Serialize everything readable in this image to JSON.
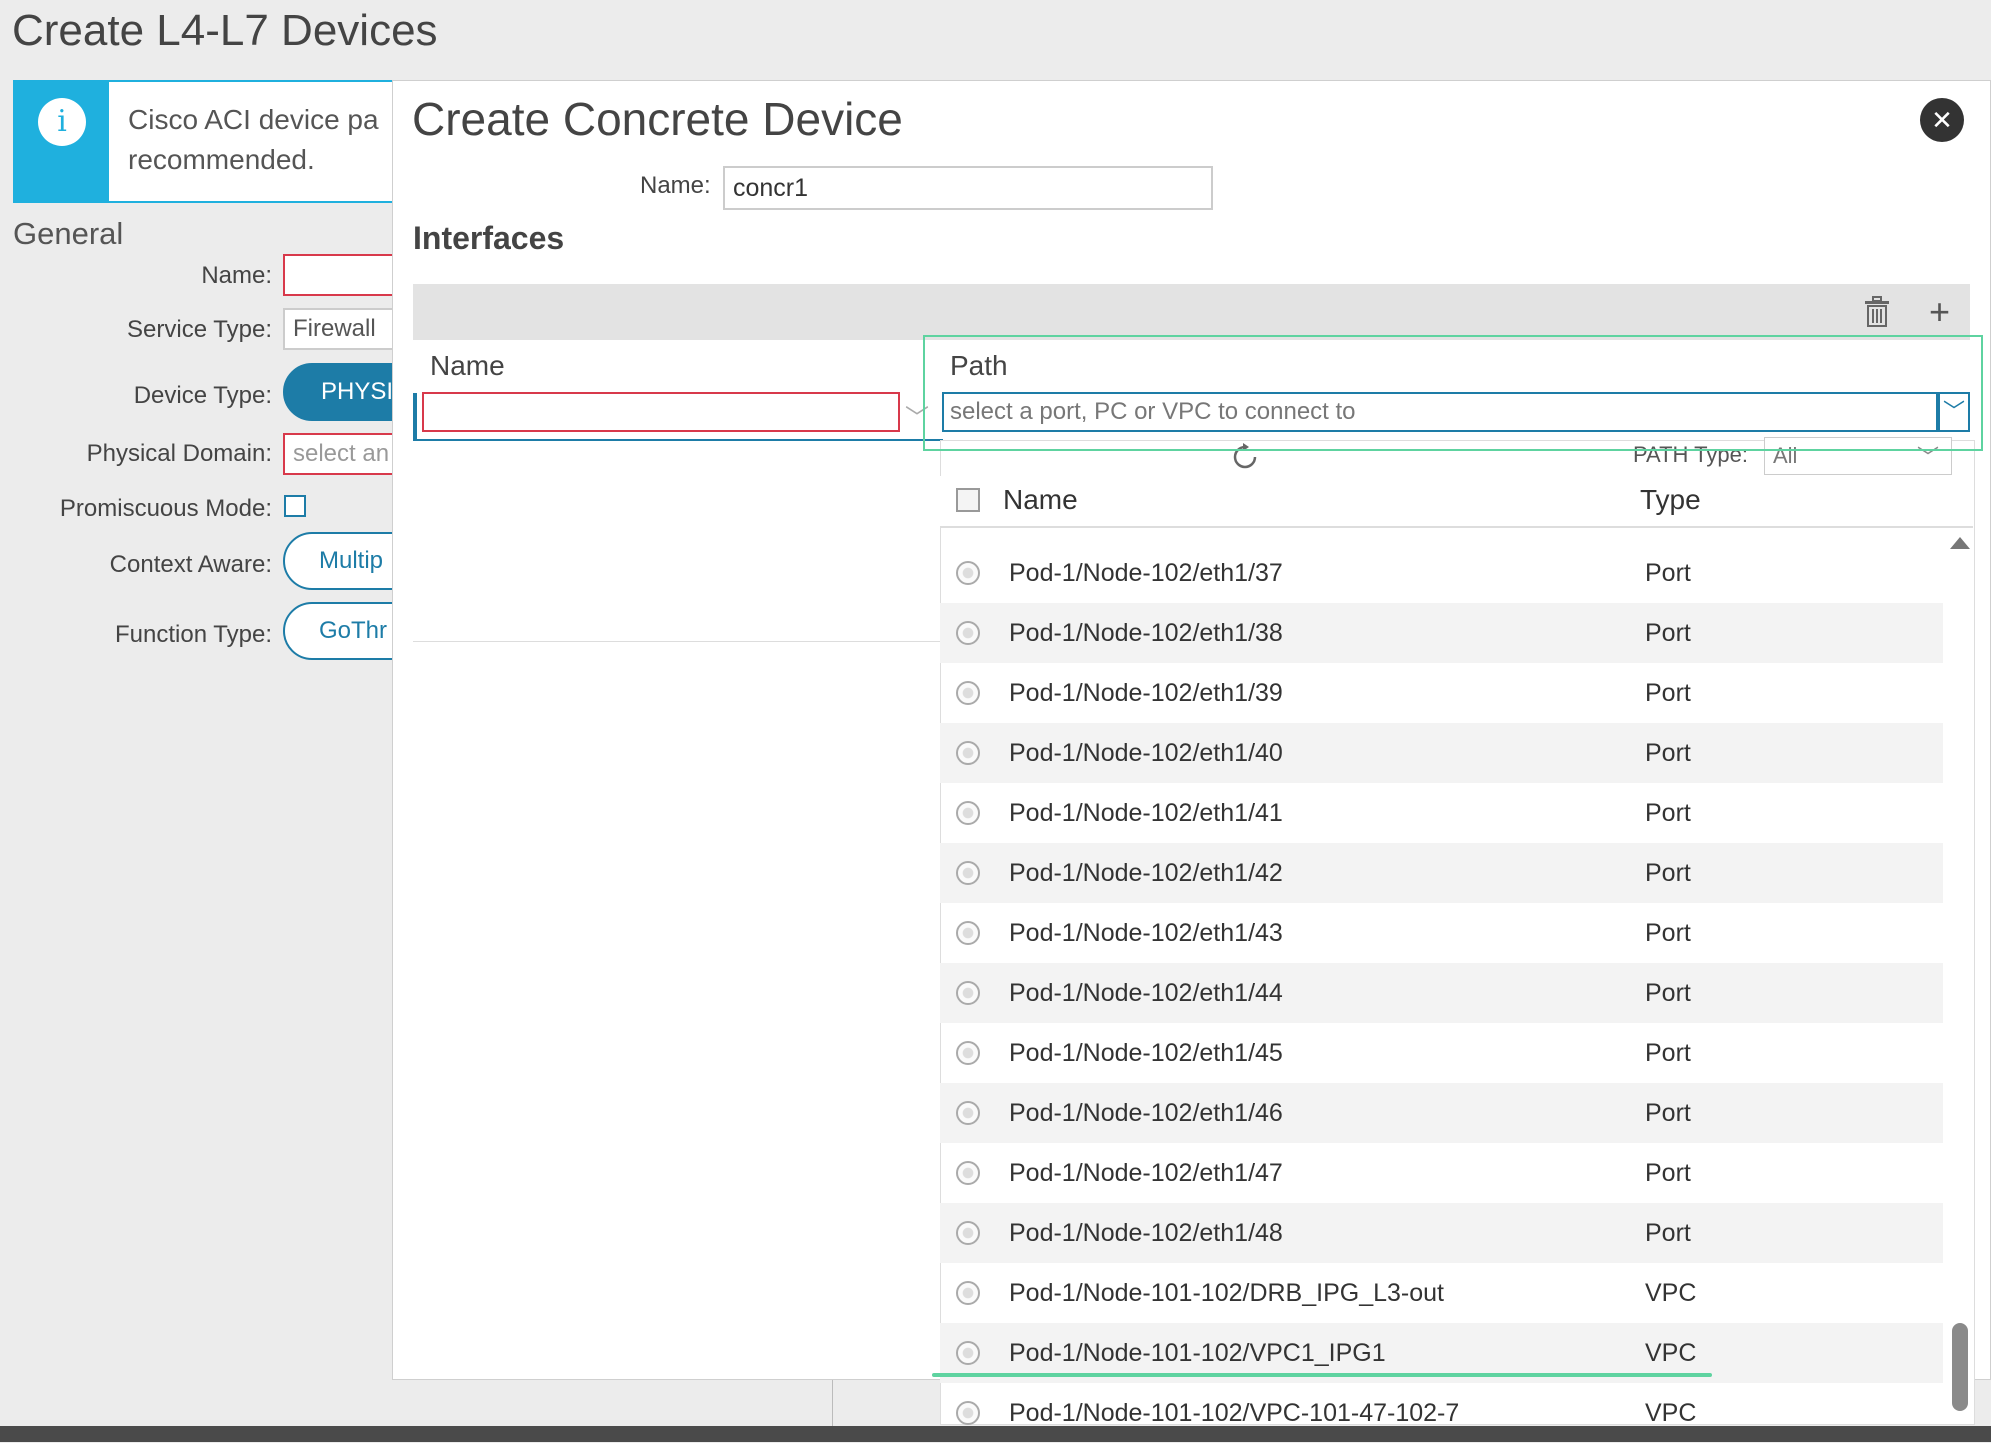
{
  "page": {
    "title": "Create L4-L7 Devices",
    "info_text": "Cisco ACI device pa recommended.",
    "section": "General",
    "fields": {
      "name_label": "Name:",
      "service_type_label": "Service Type:",
      "service_type_value": "Firewall",
      "device_type_label": "Device Type:",
      "device_type_value": "PHYSI",
      "physical_domain_label": "Physical Domain:",
      "physical_domain_placeholder": "select an",
      "promiscuous_label": "Promiscuous Mode:",
      "context_aware_label": "Context Aware:",
      "context_aware_value": "Multip",
      "function_type_label": "Function Type:",
      "function_type_value": "GoThr"
    }
  },
  "modal": {
    "title": "Create Concrete Device",
    "close_icon": "close-icon",
    "name_label": "Name:",
    "name_value": "concr1",
    "interfaces_label": "Interfaces",
    "columns": {
      "name": "Name",
      "path": "Path"
    },
    "path_placeholder": "select a port, PC or VPC to connect to",
    "icons": [
      "trash-icon",
      "plus-icon",
      "refresh-icon",
      "chevron-down-icon"
    ]
  },
  "dropdown": {
    "path_type_label": "PATH Type:",
    "path_type_value": "All",
    "headers": {
      "name": "Name",
      "type": "Type"
    },
    "rows": [
      {
        "name": "Pod-1/Node-102/eth1/37",
        "type": "Port"
      },
      {
        "name": "Pod-1/Node-102/eth1/38",
        "type": "Port"
      },
      {
        "name": "Pod-1/Node-102/eth1/39",
        "type": "Port"
      },
      {
        "name": "Pod-1/Node-102/eth1/40",
        "type": "Port"
      },
      {
        "name": "Pod-1/Node-102/eth1/41",
        "type": "Port"
      },
      {
        "name": "Pod-1/Node-102/eth1/42",
        "type": "Port"
      },
      {
        "name": "Pod-1/Node-102/eth1/43",
        "type": "Port"
      },
      {
        "name": "Pod-1/Node-102/eth1/44",
        "type": "Port"
      },
      {
        "name": "Pod-1/Node-102/eth1/45",
        "type": "Port"
      },
      {
        "name": "Pod-1/Node-102/eth1/46",
        "type": "Port"
      },
      {
        "name": "Pod-1/Node-102/eth1/47",
        "type": "Port"
      },
      {
        "name": "Pod-1/Node-102/eth1/48",
        "type": "Port"
      },
      {
        "name": "Pod-1/Node-101-102/DRB_IPG_L3-out",
        "type": "VPC"
      },
      {
        "name": "Pod-1/Node-101-102/VPC1_IPG1",
        "type": "VPC"
      },
      {
        "name": "Pod-1/Node-101-102/VPC-101-47-102-7",
        "type": "VPC"
      }
    ]
  },
  "colors": {
    "accent": "#1d7ca7",
    "info": "#1fb0de",
    "error": "#d8394b",
    "highlight": "#5ed3a0"
  }
}
